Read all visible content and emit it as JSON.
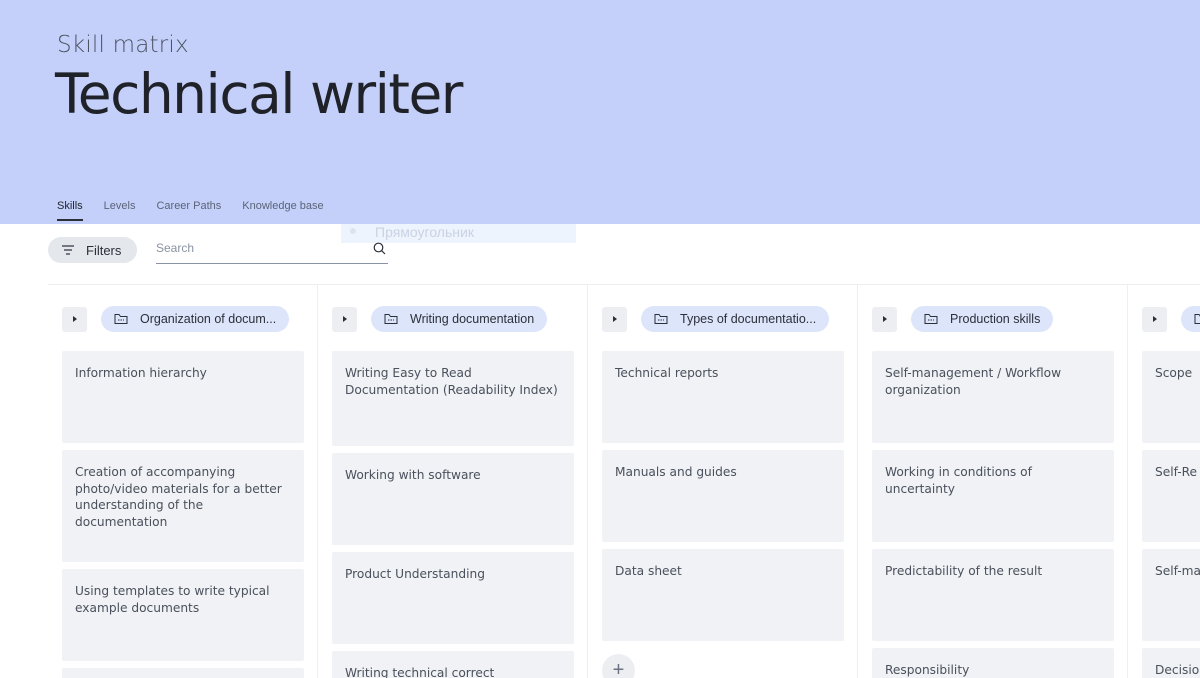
{
  "header": {
    "subtitle": "Skill matrix",
    "title": "Technical writer",
    "tabs": [
      "Skills",
      "Levels",
      "Career Paths",
      "Knowledge base"
    ]
  },
  "ghost_label": "Прямоугольник",
  "toolbar": {
    "filters_label": "Filters",
    "search_placeholder": "Search"
  },
  "columns": [
    {
      "label": "Organization of docum...",
      "cards": [
        "Information hierarchy",
        "Creation of accompanying photo/video materials for a better understanding of the documentation",
        "Using templates to write typical example documents",
        ""
      ]
    },
    {
      "label": "Writing documentation",
      "cards": [
        "Writing Easy to Read Documentation (Readability Index)",
        "Working with software",
        "Product Understanding",
        "Writing technical correct"
      ]
    },
    {
      "label": "Types of documentatio...",
      "cards": [
        "Technical reports",
        "Manuals and guides",
        "Data sheet"
      ],
      "add_label": "+"
    },
    {
      "label": "Production skills",
      "cards": [
        "Self-management / Workflow organization",
        "Working in conditions of uncertainty",
        "Predictability of the result",
        "Responsibility"
      ]
    },
    {
      "label": "",
      "cards": [
        "Scope",
        "Self-Re",
        "Self-ma",
        "Decisio"
      ]
    }
  ],
  "colors": {
    "header_bg": "#c4d0f9",
    "pill_bg": "#dde5fb",
    "card_bg": "#f0f2f5"
  }
}
